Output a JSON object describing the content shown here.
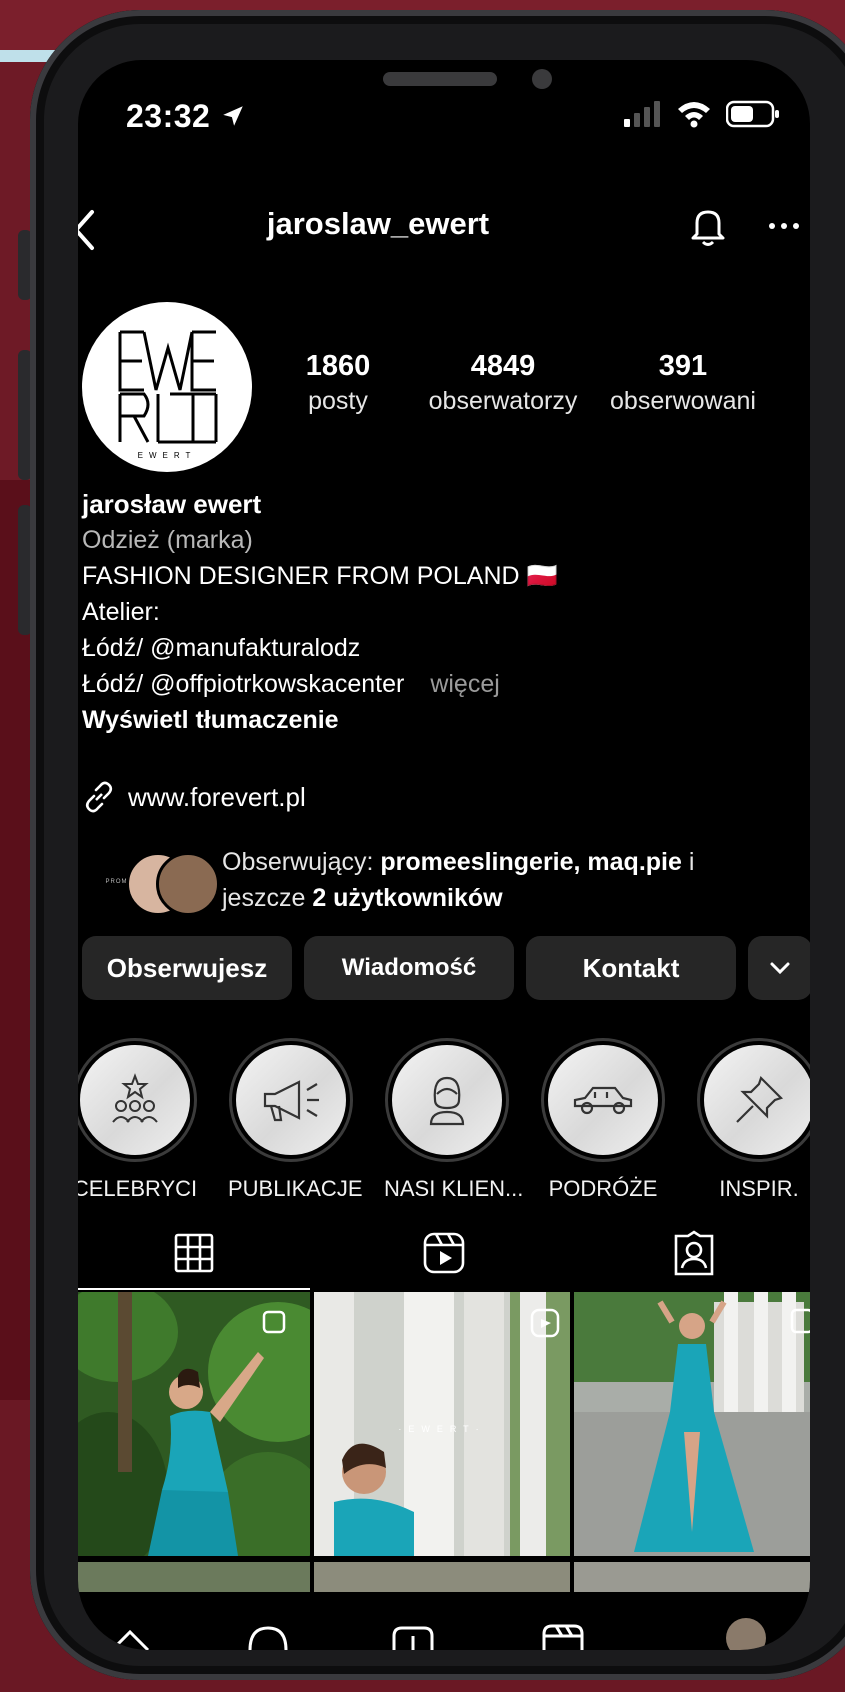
{
  "status": {
    "time": "23:32"
  },
  "profile": {
    "username": "jaroslaw_ewert",
    "avatar_text": "EWERT",
    "stats": [
      {
        "value": "1860",
        "label": "posty"
      },
      {
        "value": "4849",
        "label": "obserwatorzy"
      },
      {
        "value": "391",
        "label": "obserwowani"
      }
    ],
    "display_name": "jarosław ewert",
    "category": "Odzież (marka)",
    "bio_lines": [
      "FASHION DESIGNER FROM POLAND 🇵🇱",
      "Atelier:",
      "Łódź/ @manufakturalodz",
      "Łódź/ @offpiotrkowskacenter"
    ],
    "more_label": "więcej",
    "translate_label": "Wyświetl tłumaczenie",
    "website": "www.forevert.pl",
    "followed_by": {
      "prefix": "Obserwujący: ",
      "names": "promeeslingerie, maq.pie",
      "conj": " i",
      "line2_prefix": "jeszcze ",
      "line2_bold": "2 użytkowników",
      "avatar1_text": "PROMEES"
    }
  },
  "actions": {
    "follow": "Obserwujesz",
    "message": "Wiadomość",
    "contact": "Kontakt"
  },
  "highlights": [
    {
      "label": "CELEBRYCI",
      "icon": "celebrity-icon"
    },
    {
      "label": "PUBLIKACJE",
      "icon": "megaphone-icon"
    },
    {
      "label": "NASI KLIEN...",
      "icon": "client-icon"
    },
    {
      "label": "PODRÓŻE",
      "icon": "car-icon"
    },
    {
      "label": "INSPIR.",
      "icon": "pin-icon"
    }
  ],
  "tabs": [
    "grid-icon",
    "reels-icon",
    "tagged-icon"
  ],
  "colors": {
    "background": "#000000",
    "button": "#262626",
    "dress": "#1aa5b8"
  }
}
